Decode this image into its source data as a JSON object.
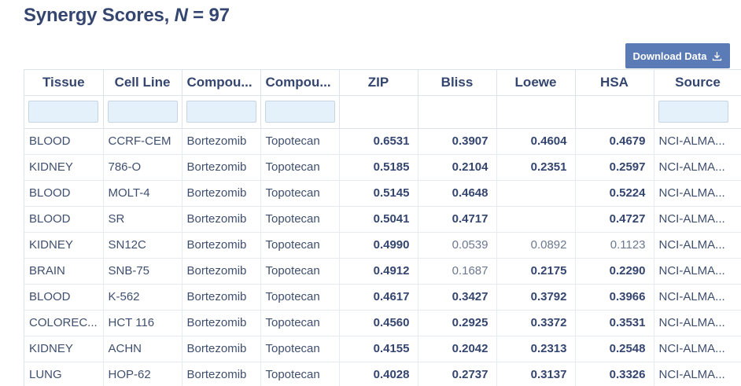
{
  "header": {
    "title_prefix": "Synergy Scores, ",
    "title_n": "N",
    "title_suffix": " = 97"
  },
  "toolbar": {
    "download_label": "Download Data",
    "download_icon": "download-icon"
  },
  "table": {
    "columns": [
      "Tissue",
      "Cell Line",
      "Compou...",
      "Compou...",
      "ZIP",
      "Bliss",
      "Loewe",
      "HSA",
      "Source"
    ],
    "filters": {
      "tissue": "",
      "cell_line": "",
      "compound_1": "",
      "compound_2": "",
      "source": ""
    },
    "rows": [
      {
        "tissue": "BLOOD",
        "cell_line": "CCRF-CEM",
        "compound_1": "Bortezomib",
        "compound_2": "Topotecan",
        "zip": "0.6531",
        "bliss": "0.3907",
        "loewe": "0.4604",
        "hsa": "0.4679",
        "source": "NCI-ALMA...",
        "bold": [
          "zip",
          "bliss",
          "loewe",
          "hsa"
        ]
      },
      {
        "tissue": "KIDNEY",
        "cell_line": "786-O",
        "compound_1": "Bortezomib",
        "compound_2": "Topotecan",
        "zip": "0.5185",
        "bliss": "0.2104",
        "loewe": "0.2351",
        "hsa": "0.2597",
        "source": "NCI-ALMA...",
        "bold": [
          "zip",
          "bliss",
          "loewe",
          "hsa"
        ]
      },
      {
        "tissue": "BLOOD",
        "cell_line": "MOLT-4",
        "compound_1": "Bortezomib",
        "compound_2": "Topotecan",
        "zip": "0.5145",
        "bliss": "0.4648",
        "loewe": "",
        "hsa": "0.5224",
        "source": "NCI-ALMA...",
        "bold": [
          "zip",
          "bliss",
          "loewe",
          "hsa"
        ]
      },
      {
        "tissue": "BLOOD",
        "cell_line": "SR",
        "compound_1": "Bortezomib",
        "compound_2": "Topotecan",
        "zip": "0.5041",
        "bliss": "0.4717",
        "loewe": "",
        "hsa": "0.4727",
        "source": "NCI-ALMA...",
        "bold": [
          "zip",
          "bliss",
          "loewe",
          "hsa"
        ]
      },
      {
        "tissue": "KIDNEY",
        "cell_line": "SN12C",
        "compound_1": "Bortezomib",
        "compound_2": "Topotecan",
        "zip": "0.4990",
        "bliss": "0.0539",
        "loewe": "0.0892",
        "hsa": "0.1123",
        "source": "NCI-ALMA...",
        "bold": [
          "zip"
        ]
      },
      {
        "tissue": "BRAIN",
        "cell_line": "SNB-75",
        "compound_1": "Bortezomib",
        "compound_2": "Topotecan",
        "zip": "0.4912",
        "bliss": "0.1687",
        "loewe": "0.2175",
        "hsa": "0.2290",
        "source": "NCI-ALMA...",
        "bold": [
          "zip",
          "loewe",
          "hsa"
        ]
      },
      {
        "tissue": "BLOOD",
        "cell_line": "K-562",
        "compound_1": "Bortezomib",
        "compound_2": "Topotecan",
        "zip": "0.4617",
        "bliss": "0.3427",
        "loewe": "0.3792",
        "hsa": "0.3966",
        "source": "NCI-ALMA...",
        "bold": [
          "zip",
          "bliss",
          "loewe",
          "hsa"
        ]
      },
      {
        "tissue": "COLOREC...",
        "cell_line": "HCT 116",
        "compound_1": "Bortezomib",
        "compound_2": "Topotecan",
        "zip": "0.4560",
        "bliss": "0.2925",
        "loewe": "0.3372",
        "hsa": "0.3531",
        "source": "NCI-ALMA...",
        "bold": [
          "zip",
          "bliss",
          "loewe",
          "hsa"
        ]
      },
      {
        "tissue": "KIDNEY",
        "cell_line": "ACHN",
        "compound_1": "Bortezomib",
        "compound_2": "Topotecan",
        "zip": "0.4155",
        "bliss": "0.2042",
        "loewe": "0.2313",
        "hsa": "0.2548",
        "source": "NCI-ALMA...",
        "bold": [
          "zip",
          "bliss",
          "loewe",
          "hsa"
        ]
      },
      {
        "tissue": "LUNG",
        "cell_line": "HOP-62",
        "compound_1": "Bortezomib",
        "compound_2": "Topotecan",
        "zip": "0.4028",
        "bliss": "0.2737",
        "loewe": "0.3137",
        "hsa": "0.3326",
        "source": "NCI-ALMA...",
        "bold": [
          "zip",
          "bliss",
          "loewe",
          "hsa"
        ]
      }
    ]
  },
  "colors": {
    "title": "#34456f",
    "button_bg": "#5a7bb5",
    "filter_bg": "#e4f1fb"
  }
}
